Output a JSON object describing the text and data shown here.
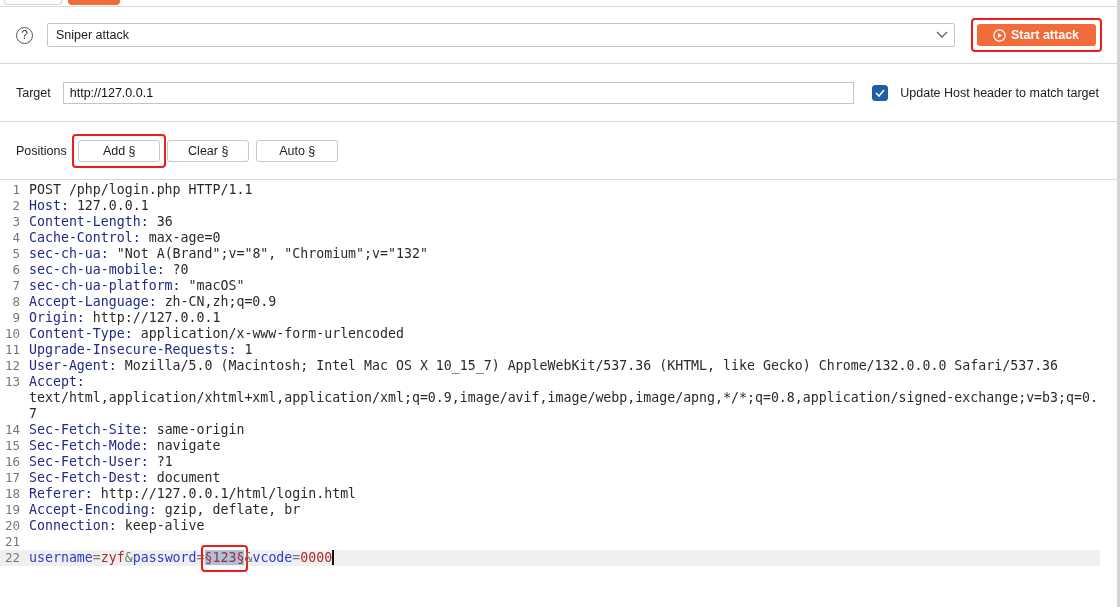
{
  "attack": {
    "help": "?",
    "type": "Sniper attack",
    "start_button": {
      "label": "Start attack",
      "annotated": true
    }
  },
  "target": {
    "label": "Target",
    "value": "http://127.0.0.1",
    "update_host": {
      "label": "Update Host header to match target",
      "checked": true
    }
  },
  "positions": {
    "label": "Positions",
    "buttons": [
      {
        "label": "Add §",
        "annotated": true
      },
      {
        "label": "Clear §",
        "annotated": false
      },
      {
        "label": "Auto §",
        "annotated": false
      }
    ]
  },
  "editor": {
    "lines": [
      {
        "number": "1",
        "kind": "plain",
        "text": "POST /php/login.php HTTP/1.1"
      },
      {
        "number": "2",
        "kind": "header",
        "name": "Host:",
        "value": "127.0.0.1"
      },
      {
        "number": "3",
        "kind": "header",
        "name": "Content-Length:",
        "value": "36"
      },
      {
        "number": "4",
        "kind": "header",
        "name": "Cache-Control:",
        "value": "max-age=0"
      },
      {
        "number": "5",
        "kind": "header",
        "name": "sec-ch-ua:",
        "value": "\"Not A(Brand\";v=\"8\", \"Chromium\";v=\"132\""
      },
      {
        "number": "6",
        "kind": "header",
        "name": "sec-ch-ua-mobile:",
        "value": "?0"
      },
      {
        "number": "7",
        "kind": "header",
        "name": "sec-ch-ua-platform:",
        "value": "\"macOS\""
      },
      {
        "number": "8",
        "kind": "header",
        "name": "Accept-Language:",
        "value": "zh-CN,zh;q=0.9"
      },
      {
        "number": "9",
        "kind": "header",
        "name": "Origin:",
        "value": "http://127.0.0.1"
      },
      {
        "number": "10",
        "kind": "header",
        "name": "Content-Type:",
        "value": "application/x-www-form-urlencoded"
      },
      {
        "number": "11",
        "kind": "header",
        "name": "Upgrade-Insecure-Requests:",
        "value": "1"
      },
      {
        "number": "12",
        "kind": "header",
        "name": "User-Agent:",
        "value": "Mozilla/5.0 (Macintosh; Intel Mac OS X 10_15_7) AppleWebKit/537.36 (KHTML, like Gecko) Chrome/132.0.0.0 Safari/537.36"
      },
      {
        "number": "13",
        "kind": "header",
        "name": "Accept:",
        "value": "text/html,application/xhtml+xml,application/xml;q=0.9,image/avif,image/webp,image/apng,*/*;q=0.8,application/signed-exchange;v=b3;q=0.7"
      },
      {
        "number": "14",
        "kind": "header",
        "name": "Sec-Fetch-Site:",
        "value": "same-origin"
      },
      {
        "number": "15",
        "kind": "header",
        "name": "Sec-Fetch-Mode:",
        "value": "navigate"
      },
      {
        "number": "16",
        "kind": "header",
        "name": "Sec-Fetch-User:",
        "value": "?1"
      },
      {
        "number": "17",
        "kind": "header",
        "name": "Sec-Fetch-Dest:",
        "value": "document"
      },
      {
        "number": "18",
        "kind": "header",
        "name": "Referer:",
        "value": "http://127.0.0.1/html/login.html"
      },
      {
        "number": "19",
        "kind": "header",
        "name": "Accept-Encoding:",
        "value": "gzip, deflate, br"
      },
      {
        "number": "20",
        "kind": "header",
        "name": "Connection:",
        "value": "keep-alive"
      },
      {
        "number": "21",
        "kind": "plain"
      },
      {
        "number": "22",
        "kind": "body",
        "current": true,
        "segments": [
          {
            "kind": "name",
            "text": "username"
          },
          {
            "kind": "sep",
            "text": "="
          },
          {
            "kind": "value",
            "text": "zyf"
          },
          {
            "kind": "sep",
            "text": "&"
          },
          {
            "kind": "name",
            "text": "password"
          },
          {
            "kind": "sep",
            "text": "="
          },
          {
            "kind": "payload",
            "text": "§123§",
            "annotated": true
          },
          {
            "kind": "sep",
            "text": "&"
          },
          {
            "kind": "name",
            "text": "vcode"
          },
          {
            "kind": "sep",
            "text": "="
          },
          {
            "kind": "value",
            "text": "0000"
          }
        ]
      }
    ]
  }
}
